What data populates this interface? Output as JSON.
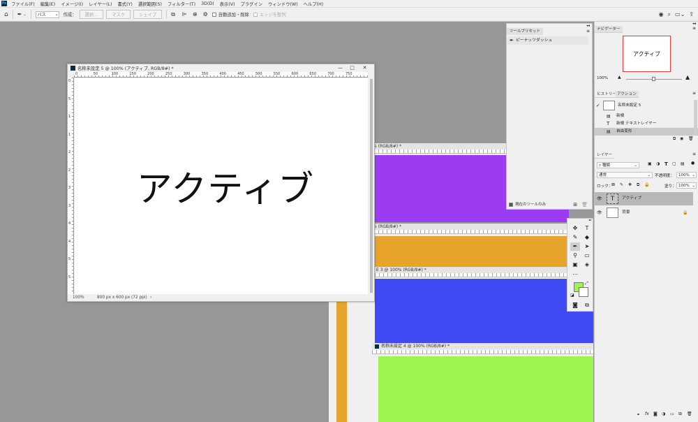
{
  "menu": {
    "app_icon": "Ps",
    "items": [
      "ファイル(F)",
      "編集(E)",
      "イメージ(I)",
      "レイヤー(L)",
      "書式(Y)",
      "選択範囲(S)",
      "フィルター(T)",
      "3D(D)",
      "表示(V)",
      "プラグイン",
      "ウィンドウ(W)",
      "ヘルプ(H)"
    ]
  },
  "options": {
    "mode_value": "パス",
    "create_label": "作成：",
    "btn_selection": "選択...",
    "btn_mask": "マスク",
    "btn_shape": "シェイプ",
    "auto_add_delete": "自動追加・削除",
    "align_edges": "エッジを整列"
  },
  "active_doc": {
    "title": "名称未設定 5 @ 100% (アクティブ, RGB/8#) *",
    "canvas_text": "アクティブ",
    "zoom": "100%",
    "doc_size": "800 px x 600 px (72 ppi)",
    "ruler_h": [
      "0",
      "50",
      "100",
      "150",
      "200",
      "250",
      "300",
      "350",
      "400",
      "450",
      "500",
      "550",
      "600",
      "650",
      "700",
      "750"
    ],
    "ruler_v": [
      "0",
      "5",
      "1",
      "1",
      "2",
      "2",
      "3",
      "3",
      "4",
      "4",
      "5",
      "5"
    ]
  },
  "bg_docs": {
    "purple_title": "% (RGB/8#) *",
    "orange_title": "% (RGB/8#) *",
    "blue_title": "E 3 @ 100% (RGB/8#) *",
    "green_title": "名称未設定 4 @ 100% (RGB/8#) *",
    "colors": {
      "purple": "#9b3cf3",
      "orange": "#e6a52a",
      "blue": "#3f4cf6",
      "green": "#9ef34c"
    }
  },
  "tool_presets": {
    "tab": "ツールプリセット",
    "item": "ピーナッツダッシュ",
    "current_tool_only": "現在のツールのみ"
  },
  "navigator": {
    "tab": "ナビゲーター",
    "thumb_text": "アクティブ",
    "zoom": "100%"
  },
  "history": {
    "tabs": [
      "ヒストリー",
      "アクション"
    ],
    "snapshot": "名称未設定 5",
    "items": [
      "新規",
      "新規 テキストレイヤー",
      "自由変形"
    ]
  },
  "layers": {
    "tab": "レイヤー",
    "filter_kind": "種類",
    "blend_mode": "通常",
    "opacity_label": "不透明度：",
    "opacity_value": "100%",
    "lock_label": "ロック：",
    "fill_label": "塗り：",
    "fill_value": "100%",
    "items": [
      "アクティブ",
      "背景"
    ]
  },
  "colors": {
    "foreground": "#9ef34c",
    "background": "#ffffff",
    "ps_blue": "#31a8ff"
  }
}
